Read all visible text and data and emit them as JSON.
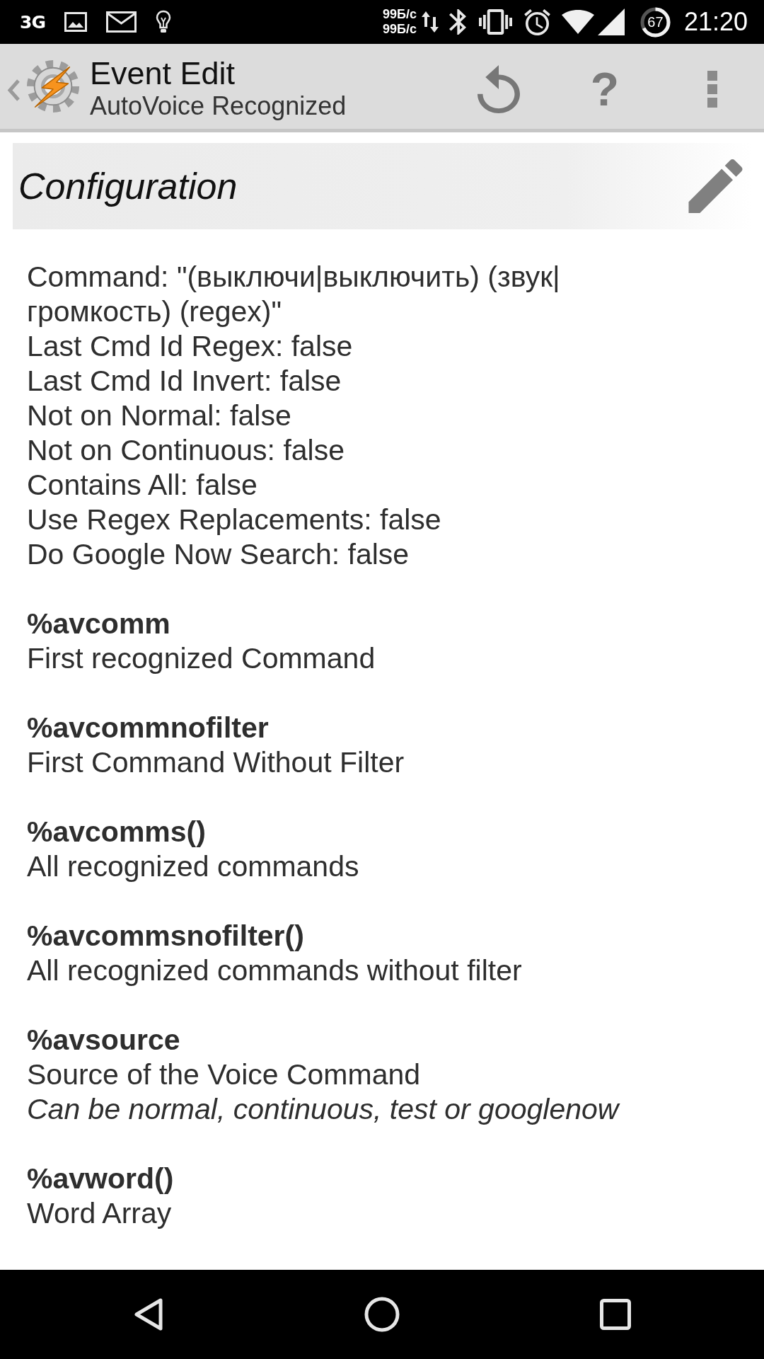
{
  "status_bar": {
    "network": "3G",
    "speeds": [
      "99Б/с",
      "99Б/с"
    ],
    "battery": "67",
    "time": "21:20"
  },
  "app_bar": {
    "title": "Event Edit",
    "subtitle": "AutoVoice Recognized",
    "help": "?"
  },
  "section": {
    "title": "Configuration"
  },
  "settings": [
    "Command: \"(выключи|выключить) (звук|громкость) (regex)\"",
    "Last Cmd Id Regex: false",
    "Last Cmd Id Invert: false",
    "Not on Normal: false",
    "Not on Continuous: false",
    "Contains All: false",
    "Use Regex Replacements: false",
    "Do Google Now Search: false"
  ],
  "variables": [
    {
      "name": "%avcomm",
      "description": "First recognized Command"
    },
    {
      "name": "%avcommnofilter",
      "description": "First Command Without Filter"
    },
    {
      "name": "%avcomms()",
      "description": "All recognized commands"
    },
    {
      "name": "%avcommsnofilter()",
      "description": "All recognized commands without filter"
    },
    {
      "name": "%avsource",
      "description": "Source of the Voice Command",
      "note": "Can be normal, continuous, test or googlenow"
    },
    {
      "name": "%avword()",
      "description": "Word Array"
    }
  ]
}
